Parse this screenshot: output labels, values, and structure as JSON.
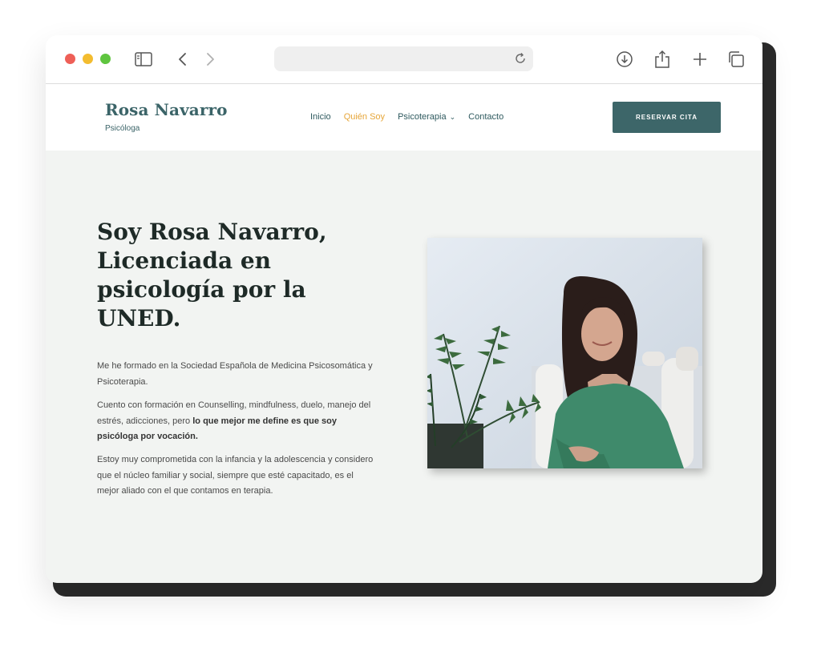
{
  "site": {
    "brand_name": "Rosa Navarro",
    "brand_subtitle": "Psicóloga",
    "nav": {
      "inicio": "Inicio",
      "quien_soy": "Quién Soy",
      "psicoterapia": "Psicoterapia",
      "contacto": "Contacto"
    },
    "cta_label": "RESERVAR CITA"
  },
  "hero": {
    "title": "Soy Rosa Navarro, Licenciada en psicología por la UNED.",
    "para1": "Me he formado en la Sociedad Española de Medicina Psicosomática y Psicoterapia.",
    "para2_lead": "Cuento con formación en Counselling, mindfulness, duelo, manejo del estrés, adicciones, pero ",
    "para2_bold": "lo que mejor me define es que soy psicóloga por vocación.",
    "para3": "Estoy muy comprometida con la infancia y la adolescencia y considero que el núcleo familiar y social, siempre que esté capacitado, es el mejor aliado con el que contamos en terapia."
  },
  "colors": {
    "accent": "#3d6669",
    "nav_active": "#e6a63a",
    "page_bg": "#f2f4f2",
    "title_text": "#1e2a27"
  },
  "icons": {
    "sidebar": "sidebar-icon",
    "back": "chevron-left-icon",
    "forward": "chevron-right-icon",
    "reload": "reload-icon",
    "download": "download-icon",
    "share": "share-icon",
    "new_tab": "plus-icon",
    "tabs": "tabs-overview-icon",
    "dropdown": "chevron-down-icon"
  }
}
